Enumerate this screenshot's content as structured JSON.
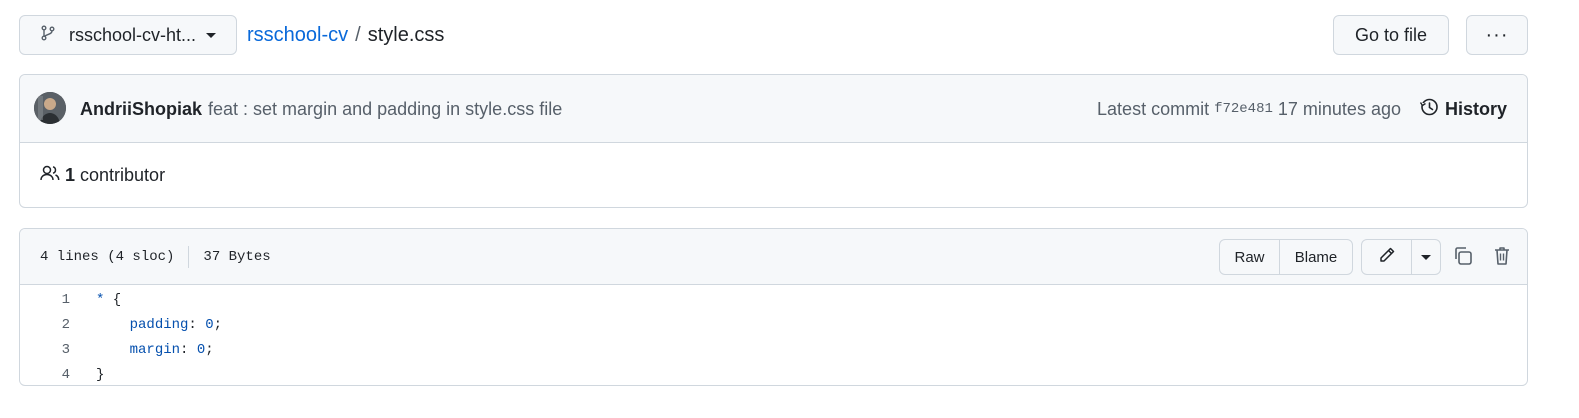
{
  "breadcrumb": {
    "branch": "rsschool-cv-ht...",
    "repo": "rsschool-cv",
    "separator": "/",
    "file": "style.css"
  },
  "actions": {
    "go_to_file": "Go to file",
    "more": "···"
  },
  "commit": {
    "author": "AndriiShopiak",
    "message": "feat : set margin and padding in style.css file",
    "latest_label": "Latest commit",
    "sha": "f72e481",
    "time": "17 minutes ago",
    "history": "History"
  },
  "contributors": {
    "count": "1",
    "label": "contributor"
  },
  "file": {
    "lines": "4 lines (4 sloc)",
    "size": "37 Bytes",
    "raw": "Raw",
    "blame": "Blame"
  },
  "code": [
    {
      "num": "1",
      "indent": "",
      "a": "*",
      "b": " {",
      "c": ""
    },
    {
      "num": "2",
      "indent": "    ",
      "a": "padding",
      "b": ": ",
      "c": "0",
      "d": ";"
    },
    {
      "num": "3",
      "indent": "    ",
      "a": "margin",
      "b": ": ",
      "c": "0",
      "d": ";"
    },
    {
      "num": "4",
      "indent": "",
      "a": "}",
      "b": "",
      "c": ""
    }
  ],
  "icons": {
    "branch": "git-branch-icon",
    "history": "history-icon",
    "people": "people-icon",
    "edit": "pencil-icon",
    "copy": "copy-icon",
    "delete": "trash-icon"
  },
  "colors": {
    "link": "#0969da",
    "border": "#d0d7de",
    "header_bg": "#f6f8fa",
    "code_keyword": "#0550ae"
  }
}
